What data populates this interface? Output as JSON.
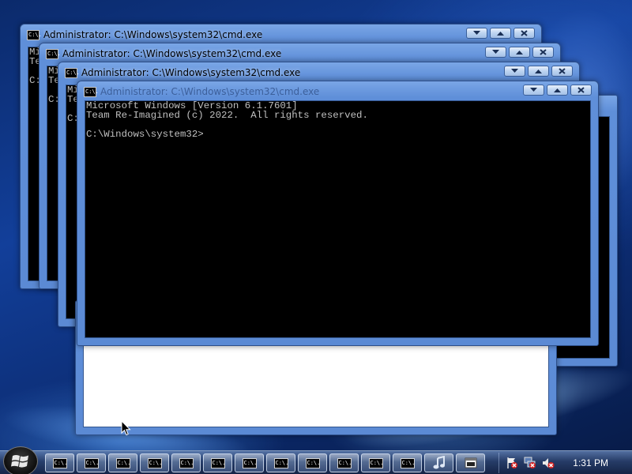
{
  "windows": [
    {
      "title": "Administrator: C:\\Windows\\system32\\cmd.exe",
      "lines": [
        "Mi",
        "Te",
        "",
        "C:"
      ]
    },
    {
      "title": "Administrator: C:\\Windows\\system32\\cmd.exe",
      "lines": [
        "Mi",
        "Te",
        "",
        "C:"
      ]
    },
    {
      "title": "Administrator: C:\\Windows\\system32\\cmd.exe",
      "lines": [
        "Mi",
        "Te",
        "",
        "C:"
      ]
    },
    {
      "title": "Administrator: C:\\Windows\\system32\\cmd.exe",
      "lines": [
        "Microsoft Windows [Version 6.1.7601]",
        "Team Re-Imagined (c) 2022.  All rights reserved.",
        "",
        "C:\\Windows\\system32>"
      ]
    }
  ],
  "app_icon_label": "C:\\.",
  "window_controls": {
    "minimize": "minimize-icon",
    "maximize": "maximize-icon",
    "close": "close-icon"
  },
  "taskbar": {
    "start_icon": "windows-logo-icon",
    "buttons": [
      {
        "icon": "cmd-icon"
      },
      {
        "icon": "cmd-icon"
      },
      {
        "icon": "cmd-icon"
      },
      {
        "icon": "cmd-icon"
      },
      {
        "icon": "cmd-icon"
      },
      {
        "icon": "cmd-icon"
      },
      {
        "icon": "cmd-icon"
      },
      {
        "icon": "cmd-icon"
      },
      {
        "icon": "cmd-icon"
      },
      {
        "icon": "cmd-icon"
      },
      {
        "icon": "cmd-icon"
      },
      {
        "icon": "cmd-icon"
      },
      {
        "icon": "media-player-icon"
      },
      {
        "icon": "window-app-icon"
      }
    ],
    "tray": {
      "icons": [
        "action-center-flag-icon",
        "network-disconnected-icon",
        "volume-muted-icon"
      ],
      "time": "1:31 PM"
    }
  },
  "colors": {
    "title_bar": "#5f8fd9",
    "console_bg": "#000000",
    "console_text": "#c0c0c0"
  }
}
